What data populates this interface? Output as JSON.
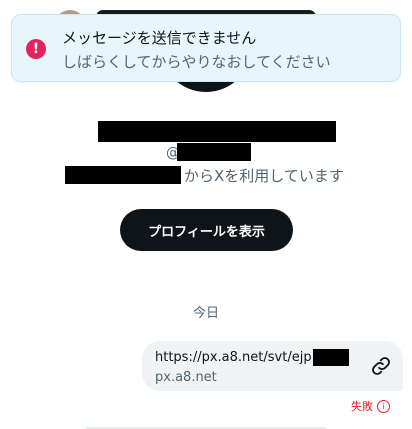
{
  "toast": {
    "icon": "!",
    "title": "メッセージを送信できません",
    "subtitle": "しばらくしてからやりなおしてください",
    "accent_color": "#e0245e"
  },
  "profile": {
    "handle_prefix": "@",
    "since_suffix": "からXを利用しています",
    "view_profile_label": "プロフィールを表示"
  },
  "conversation": {
    "date_separator": "今日",
    "message": {
      "url": "https://px.a8.net/svt/ejp",
      "domain": "px.a8.net",
      "status_label": "失敗",
      "status_icon": "i"
    }
  }
}
